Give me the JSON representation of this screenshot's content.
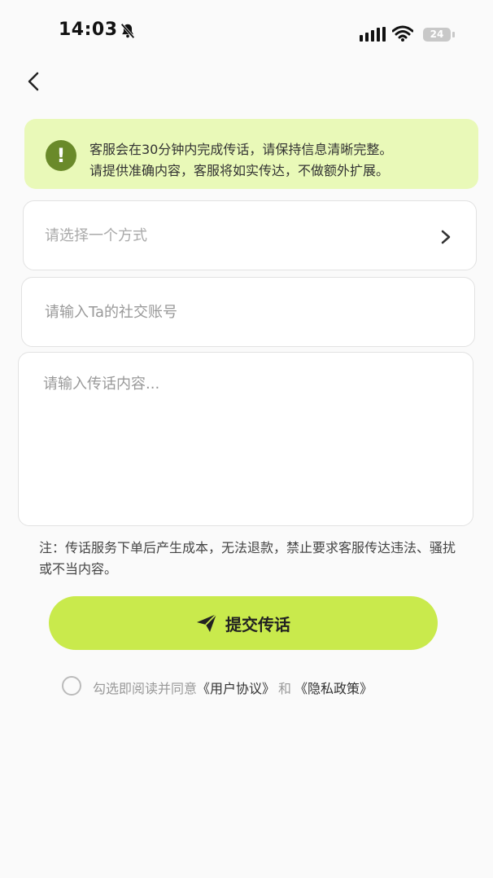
{
  "status_bar": {
    "time": "14:03",
    "battery": "24"
  },
  "notice": {
    "line1": "客服会在30分钟内完成传话，请保持信息清晰完整。",
    "line2": "请提供准确内容，客服将如实传达，不做额外扩展。"
  },
  "form": {
    "select_placeholder": "请选择一个方式",
    "account_placeholder": "请输入Ta的社交账号",
    "content_placeholder": "请输入传话内容..."
  },
  "note": "注：传话服务下单后产生成本，无法退款，禁止要求客服传达违法、骚扰或不当内容。",
  "submit": {
    "label": "提交传话"
  },
  "agreement": {
    "prefix": "勾选即阅读并同意",
    "user_agreement": "《用户协议》",
    "and": "和",
    "privacy_policy": "《隐私政策》"
  },
  "colors": {
    "accent": "#c9ea4c",
    "notice_bg": "#e9f9b8",
    "notice_icon": "#6a8a2a"
  }
}
